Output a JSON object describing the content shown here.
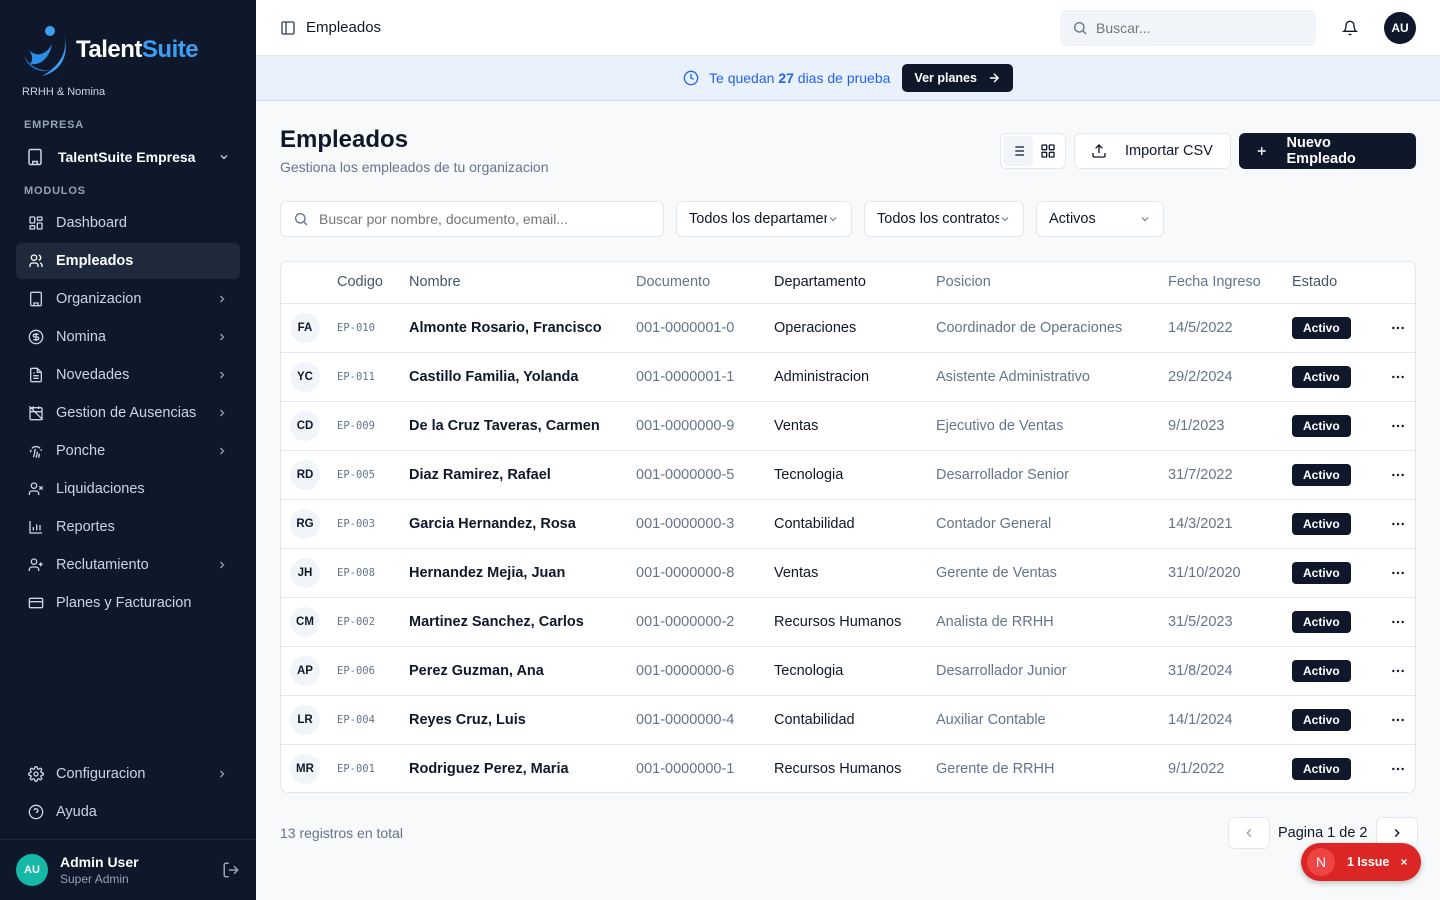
{
  "brand": {
    "name_part1": "Talent",
    "name_part2": "Suite",
    "tagline": "RRHH & Nomina",
    "accent": "#3b9ff5"
  },
  "sidebar": {
    "company_section": "EMPRESA",
    "company_name": "TalentSuite Empresa",
    "modules_section": "MODULOS",
    "items": [
      {
        "label": "Dashboard",
        "icon": "layout-grid-icon"
      },
      {
        "label": "Empleados",
        "icon": "users-icon",
        "active": true
      },
      {
        "label": "Organizacion",
        "icon": "building-icon",
        "expandable": true
      },
      {
        "label": "Nomina",
        "icon": "dollar-circle-icon",
        "expandable": true
      },
      {
        "label": "Novedades",
        "icon": "file-text-icon",
        "expandable": true
      },
      {
        "label": "Gestion de Ausencias",
        "icon": "calendar-off-icon",
        "expandable": true
      },
      {
        "label": "Ponche",
        "icon": "fingerprint-icon",
        "expandable": true
      },
      {
        "label": "Liquidaciones",
        "icon": "user-x-icon"
      },
      {
        "label": "Reportes",
        "icon": "bar-chart-icon"
      },
      {
        "label": "Reclutamiento",
        "icon": "user-plus-icon",
        "expandable": true
      },
      {
        "label": "Planes y Facturacion",
        "icon": "credit-card-icon"
      }
    ],
    "bottom_items": [
      {
        "label": "Configuracion",
        "icon": "settings-icon",
        "expandable": true
      },
      {
        "label": "Ayuda",
        "icon": "help-circle-icon"
      }
    ],
    "user": {
      "initials": "AU",
      "name": "Admin User",
      "role": "Super Admin"
    }
  },
  "topbar": {
    "title": "Empleados",
    "search_placeholder": "Buscar...",
    "avatar_initials": "AU"
  },
  "banner": {
    "text_before": "Te quedan",
    "days": "27",
    "text_after": "dias de prueba",
    "button": "Ver planes"
  },
  "page": {
    "title": "Empleados",
    "subtitle": "Gestiona los empleados de tu organizacion",
    "import_button": "Importar CSV",
    "new_button": "Nuevo Empleado"
  },
  "filters": {
    "search_placeholder": "Buscar por nombre, documento, email...",
    "department": "Todos los departamentos",
    "contract": "Todos los contratos",
    "status": "Activos"
  },
  "table": {
    "columns": [
      "Codigo",
      "Nombre",
      "Documento",
      "Departamento",
      "Posicion",
      "Fecha Ingreso",
      "Estado"
    ],
    "rows": [
      {
        "initials": "FA",
        "code": "EP-010",
        "name": "Almonte Rosario, Francisco",
        "doc": "001-0000001-0",
        "dept": "Operaciones",
        "pos": "Coordinador de Operaciones",
        "date": "14/5/2022",
        "status": "Activo"
      },
      {
        "initials": "YC",
        "code": "EP-011",
        "name": "Castillo Familia, Yolanda",
        "doc": "001-0000001-1",
        "dept": "Administracion",
        "pos": "Asistente Administrativo",
        "date": "29/2/2024",
        "status": "Activo"
      },
      {
        "initials": "CD",
        "code": "EP-009",
        "name": "De la Cruz Taveras, Carmen",
        "doc": "001-0000000-9",
        "dept": "Ventas",
        "pos": "Ejecutivo de Ventas",
        "date": "9/1/2023",
        "status": "Activo"
      },
      {
        "initials": "RD",
        "code": "EP-005",
        "name": "Diaz Ramirez, Rafael",
        "doc": "001-0000000-5",
        "dept": "Tecnologia",
        "pos": "Desarrollador Senior",
        "date": "31/7/2022",
        "status": "Activo"
      },
      {
        "initials": "RG",
        "code": "EP-003",
        "name": "Garcia Hernandez, Rosa",
        "doc": "001-0000000-3",
        "dept": "Contabilidad",
        "pos": "Contador General",
        "date": "14/3/2021",
        "status": "Activo"
      },
      {
        "initials": "JH",
        "code": "EP-008",
        "name": "Hernandez Mejia, Juan",
        "doc": "001-0000000-8",
        "dept": "Ventas",
        "pos": "Gerente de Ventas",
        "date": "31/10/2020",
        "status": "Activo"
      },
      {
        "initials": "CM",
        "code": "EP-002",
        "name": "Martinez Sanchez, Carlos",
        "doc": "001-0000000-2",
        "dept": "Recursos Humanos",
        "pos": "Analista de RRHH",
        "date": "31/5/2023",
        "status": "Activo"
      },
      {
        "initials": "AP",
        "code": "EP-006",
        "name": "Perez Guzman, Ana",
        "doc": "001-0000000-6",
        "dept": "Tecnologia",
        "pos": "Desarrollador Junior",
        "date": "31/8/2024",
        "status": "Activo"
      },
      {
        "initials": "LR",
        "code": "EP-004",
        "name": "Reyes Cruz, Luis",
        "doc": "001-0000000-4",
        "dept": "Contabilidad",
        "pos": "Auxiliar Contable",
        "date": "14/1/2024",
        "status": "Activo"
      },
      {
        "initials": "MR",
        "code": "EP-001",
        "name": "Rodriguez Perez, Maria",
        "doc": "001-0000000-1",
        "dept": "Recursos Humanos",
        "pos": "Gerente de RRHH",
        "date": "9/1/2022",
        "status": "Activo"
      }
    ]
  },
  "footer": {
    "total": "13 registros en total",
    "page_info": "Pagina 1 de 2"
  },
  "issue_badge": {
    "letter": "N",
    "label": "1 Issue",
    "color": "#dc2626"
  }
}
